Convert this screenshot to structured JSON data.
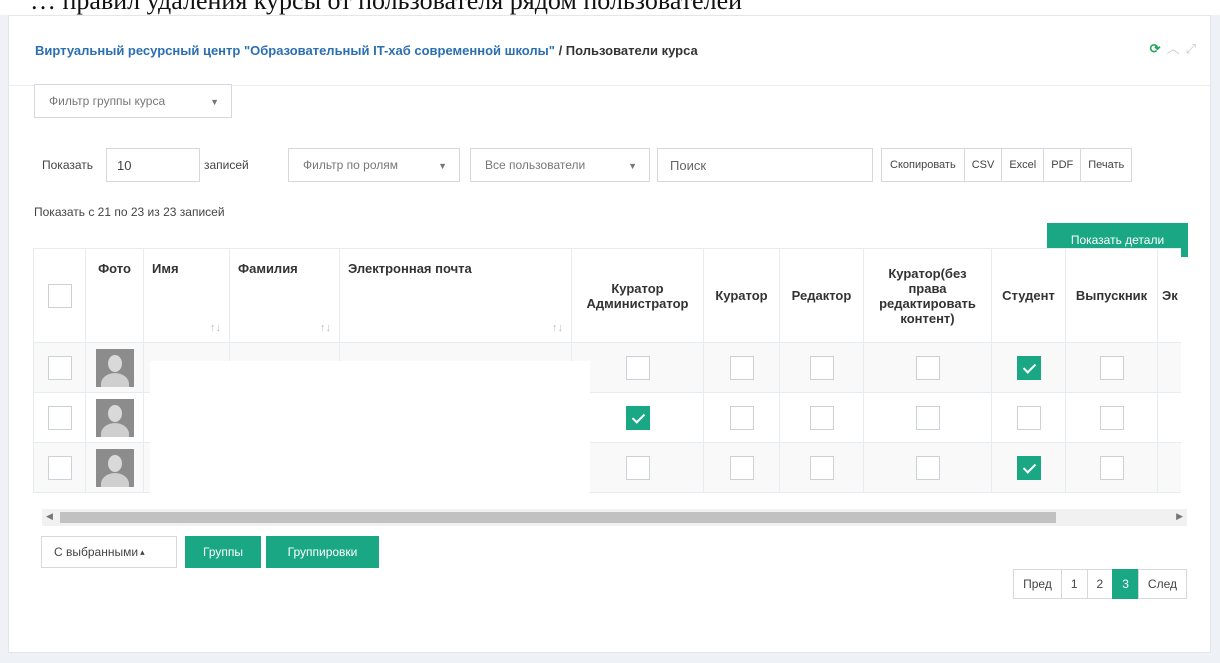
{
  "top_text": "… правил удаления курсы от пользователя рядом пользователей",
  "header": {
    "breadcrumb_link": "Виртуальный ресурсный центр \"Образовательный IT-хаб современной школы\"",
    "breadcrumb_sep": " / ",
    "breadcrumb_current": "Пользователи курса"
  },
  "group_filter": {
    "label": "Фильтр группы курса"
  },
  "toolbar": {
    "show_label": "Показать",
    "page_size": "10",
    "records_label": "записей",
    "role_filter": "Фильтр по ролям",
    "users_filter": "Все пользователи",
    "search_placeholder": "Поиск",
    "export_buttons": [
      "Скопировать",
      "CSV",
      "Excel",
      "PDF",
      "Печать"
    ]
  },
  "info_text": "Показать с 21 по 23 из 23 записей",
  "details_button": "Показать детали",
  "table": {
    "columns": {
      "photo": "Фото",
      "first_name": "Имя",
      "last_name": "Фамилия",
      "email": "Электронная почта",
      "curator_admin": "Куратор Администратор",
      "curator": "Куратор",
      "editor": "Редактор",
      "curator_no_edit": "Куратор(без права редактировать контент)",
      "student": "Студент",
      "graduate": "Выпускник",
      "next": "Эк"
    },
    "sort_icon": "↑↓",
    "rows": [
      {
        "curator_admin": false,
        "curator": false,
        "editor": false,
        "curator_no_edit": false,
        "student": true,
        "graduate": false
      },
      {
        "curator_admin": true,
        "curator": false,
        "editor": false,
        "curator_no_edit": false,
        "student": false,
        "graduate": false
      },
      {
        "curator_admin": false,
        "curator": false,
        "editor": false,
        "curator_no_edit": false,
        "student": true,
        "graduate": false
      }
    ]
  },
  "bottom": {
    "bulk_action": "С выбранными",
    "bulk_caret": "▴",
    "groups_button": "Группы",
    "groupings_button": "Группировки"
  },
  "pagination": {
    "prev": "Пред",
    "pages": [
      "1",
      "2",
      "3"
    ],
    "active": "3",
    "next": "След"
  },
  "colors": {
    "accent": "#1aa884",
    "link": "#2a6fb0",
    "reload": "#26a65b"
  },
  "icons": {
    "reload": "refresh-icon",
    "collapse": "chevron-up-icon",
    "fullscreen": "expand-icon",
    "select_caret": "caret-down-icon"
  }
}
